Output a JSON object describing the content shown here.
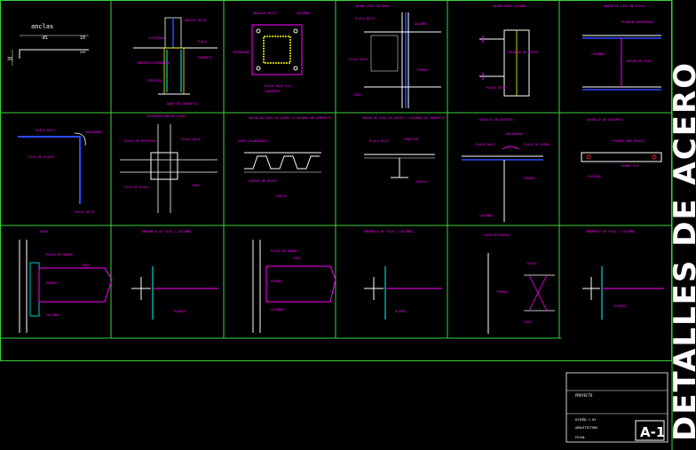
{
  "sheet": {
    "title_vertical": "DETALLES DE ACERO",
    "sheet_number": "A-1",
    "project_label": "PROYECTO",
    "title_block_line1": "DISEÑO C-03",
    "title_block_line2": "ARQUITECTURA",
    "title_block_line3": "FECHA"
  },
  "row1": {
    "c1": {
      "top": "anclas",
      "dim_left": "Ø1",
      "dim_right": "10",
      "side": "35",
      "tag": "var"
    },
    "c2": {
      "labels": [
        "ANCLAS Ø3/4\"",
        "PLACA",
        "ESTRIBOS",
        "CONCRETO",
        "MORTERO EXPANSIVO",
        "CIMIENTO",
        "DADO DE CONCRETO"
      ]
    },
    "c3": {
      "labels": [
        "ANCLAJE Ø3/4\"",
        "COLUMNA",
        "SOLDADURA",
        "PLACA BASE 3/4\"",
        "CONCRETO"
      ]
    },
    "c4": {
      "labels": [
        "UNION VIGA COLUMNA",
        "PLACA Ø3/4\"",
        "COLUMNA",
        "PLACA Ø3/4\"",
        "PERNOS",
        "VIGA"
      ]
    },
    "c5": {
      "labels": [
        "UNION VIGA COLUMNA",
        "COLUMNA DE ACERO",
        "PLACA Ø3/4\""
      ]
    },
    "c6": {
      "labels": [
        "UNION DE VIGA DE ACERO",
        "PLANCHA REFORZADA",
        "COLUMNA",
        "UNION DE VIGA"
      ]
    }
  },
  "row2": {
    "c1": {
      "labels": [
        "PLACA Ø3/4\"",
        "SOLDADURA",
        "VIGA DE PLACAS",
        "PLACA Ø3/4\""
      ]
    },
    "c2": {
      "heading": "INTERSECCION DE VIGAS",
      "labels": [
        "PLACA DE REFUERZO",
        "PLACA Ø3/4\"",
        "VIGA DE PLACA",
        "VIGA"
      ]
    },
    "c3": {
      "heading": "UNION DE VIGA DE ACERO Y COLUMNA DE CONCRETO",
      "labels": [
        "LOSA COLABORANTE",
        "LAMINA DE ACERO",
        "VIGA W"
      ]
    },
    "c4": {
      "heading": "UNION DE VIGA DE ACERO Y COLUMNA DE CONCRETO",
      "labels": [
        "PLACA Ø3/4\"",
        "CONECTOR",
        "VIGA W"
      ]
    },
    "c5": {
      "heading": "DETALLE DE SOPORTE",
      "labels": [
        "SOLDADURA",
        "PLACA BASE",
        "PLACA DE ACERO",
        "PERNOS",
        "COLUMNA"
      ]
    },
    "c6": {
      "heading": "DETALLE DE SOPORTE",
      "labels": [
        "PERNOS CON TUERCA",
        "PLATINA",
        "PERNO 3/4\""
      ]
    }
  },
  "row3": {
    "c1": {
      "heading": "AXON",
      "labels": [
        "PLACA DE UNION",
        "PERNOS",
        "COLUMNA",
        "VIGA"
      ]
    },
    "c2": {
      "heading": "ENSAMBLE DE VIGA / COLUMNA",
      "labels": [
        "PLANTA"
      ]
    },
    "c3": {
      "labels": [
        "PLACA DE UNION",
        "PERNOS",
        "COLUMNA",
        "VIGA"
      ]
    },
    "c4": {
      "heading": "ENSAMBLE DE VIGA / COLUMNA",
      "labels": [
        "PLANTA"
      ]
    },
    "c5": {
      "heading": "VIGA REFORZADA",
      "labels": [
        "PLACA",
        "PERNOS",
        "VIGA"
      ]
    },
    "c6": {
      "heading": "ENSAMBLE DE VIGA / COLUMNA",
      "labels": [
        "PLANTA"
      ]
    }
  },
  "colors": {
    "grid": "#3cd23c",
    "magenta": "#ff00ff",
    "cyan": "#00ffff",
    "white": "#ffffff",
    "yellow": "#ffff00",
    "blue": "#2b4bff",
    "red": "#ff2020"
  }
}
